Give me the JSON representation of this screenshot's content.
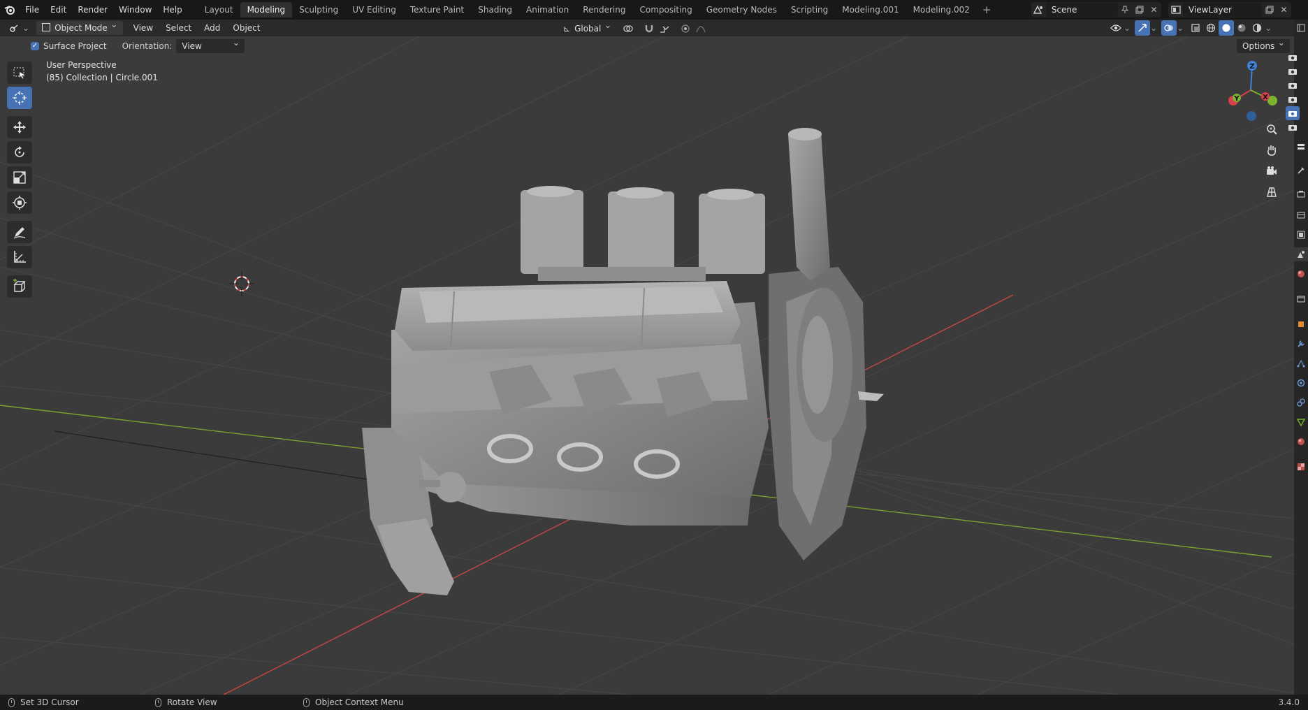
{
  "topbar": {
    "menus": [
      "File",
      "Edit",
      "Render",
      "Window",
      "Help"
    ],
    "workspaces": [
      "Layout",
      "Modeling",
      "Sculpting",
      "UV Editing",
      "Texture Paint",
      "Shading",
      "Animation",
      "Rendering",
      "Compositing",
      "Geometry Nodes",
      "Scripting",
      "Modeling.001",
      "Modeling.002"
    ],
    "active_workspace": "Modeling",
    "scene_name": "Scene",
    "view_layer_name": "ViewLayer"
  },
  "header": {
    "mode": "Object Mode",
    "menus": [
      "View",
      "Select",
      "Add",
      "Object"
    ],
    "transform_orientation": "Global",
    "options_label": "Options"
  },
  "tool_settings": {
    "surface_project_label": "Surface Project",
    "surface_project_checked": true,
    "orientation_label": "Orientation:",
    "orientation_value": "View"
  },
  "viewport": {
    "perspective_label": "User Perspective",
    "collection_label": "(85) Collection | Circle.001",
    "gizmo": {
      "z": "Z",
      "y": "Y",
      "x": "X"
    }
  },
  "toolbar": {
    "tools": [
      "select-box",
      "cursor",
      "move",
      "rotate",
      "scale",
      "transform",
      "annotate",
      "measure",
      "add-cube"
    ],
    "active_tool": "cursor"
  },
  "statusbar": {
    "left_action": "Set 3D Cursor",
    "middle_action": "Rotate View",
    "right_action": "Object Context Menu",
    "version": "3.4.0"
  },
  "colors": {
    "accent": "#4772b3",
    "axis_x": "#c94646",
    "axis_y": "#7ca12e",
    "gizmo_x": "#d9404b",
    "gizmo_y": "#7bb32f",
    "gizmo_z": "#3e83d6"
  }
}
